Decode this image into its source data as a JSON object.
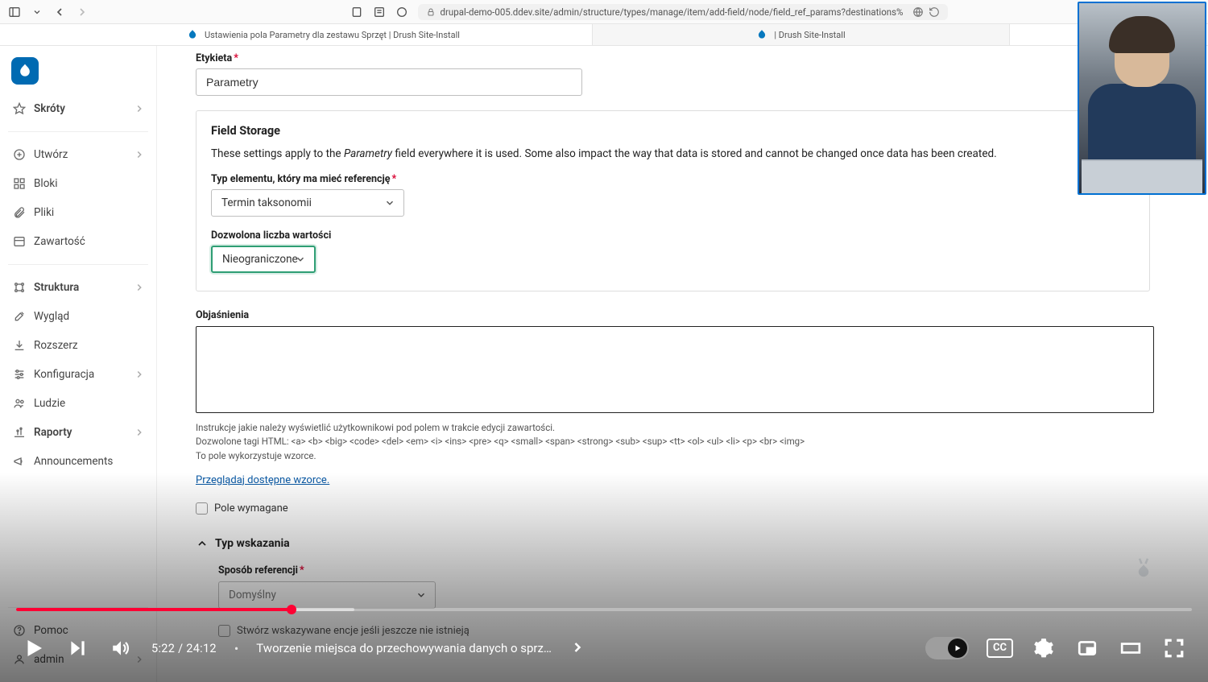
{
  "browser": {
    "url": "drupal-demo-005.ddev.site/admin/structure/types/manage/item/add-field/node/field_ref_params?destinations%",
    "tabs": [
      {
        "title": "Ustawienia pola Parametry dla zestawu Sprzęt | Drush Site-Install",
        "active": true
      },
      {
        "title": "| Drush Site-Install",
        "active": false
      }
    ]
  },
  "sidebar": {
    "items": [
      {
        "icon": "star",
        "label": "Skróty",
        "chevron": true
      },
      {
        "icon": "plus-circle",
        "label": "Utwórz",
        "chevron": true
      },
      {
        "icon": "grid",
        "label": "Bloki",
        "chevron": false
      },
      {
        "icon": "paperclip",
        "label": "Pliki",
        "chevron": false
      },
      {
        "icon": "layout",
        "label": "Zawartość",
        "chevron": false
      },
      {
        "icon": "sliders",
        "label": "Struktura",
        "chevron": true,
        "section": true
      },
      {
        "icon": "brush",
        "label": "Wygląd",
        "chevron": false
      },
      {
        "icon": "download",
        "label": "Rozszerz",
        "chevron": false
      },
      {
        "icon": "settings",
        "label": "Konfiguracja",
        "chevron": true
      },
      {
        "icon": "users",
        "label": "Ludzie",
        "chevron": false
      },
      {
        "icon": "chart",
        "label": "Raporty",
        "chevron": true
      },
      {
        "icon": "megaphone",
        "label": "Announcements",
        "chevron": false
      }
    ],
    "footer": [
      {
        "icon": "help",
        "label": "Pomoc"
      },
      {
        "icon": "user",
        "label": "admin",
        "chevron": true
      }
    ]
  },
  "form": {
    "etykieta_label": "Etykieta",
    "etykieta_value": "Parametry",
    "storage_title": "Field Storage",
    "storage_desc_prefix": "These settings apply to the ",
    "storage_desc_em": "Parametry",
    "storage_desc_suffix": " field everywhere it is used. Some also impact the way that data is stored and cannot be changed once data has been created.",
    "ref_type_label": "Typ elementu, który ma mieć referencję",
    "ref_type_value": "Termin taksonomii",
    "allowed_label": "Dozwolona liczba wartości",
    "allowed_value": "Nieograniczone",
    "help_label": "Objaśnienia",
    "help_line1": "Instrukcje jakie należy wyświetlić użytkownikowi pod polem w trakcie edycji zawartości.",
    "help_line2": "Dozwolone tagi HTML: <a> <b> <big> <code> <del> <em> <i> <ins> <pre> <q> <small> <span> <strong> <sub> <sup> <tt> <ol> <ul> <li> <p> <br> <img>",
    "help_line3": "To pole wykorzystuje wzorce.",
    "patterns_link": "Przeglądaj dostępne wzorce.",
    "required_label": "Pole wymagane",
    "ref_method_title": "Typ wskazania",
    "ref_method_label": "Sposób referencji",
    "ref_method_value": "Domyślny",
    "create_ref_label": "Stwórz wskazywane encje jeśli jeszcze nie istnieją"
  },
  "player": {
    "current": "5:22",
    "duration": "24:12",
    "chapter_sep": "•",
    "chapter_title": "Tworzenie miejsca do przechowywania danych o sprz…",
    "cc": "CC"
  }
}
